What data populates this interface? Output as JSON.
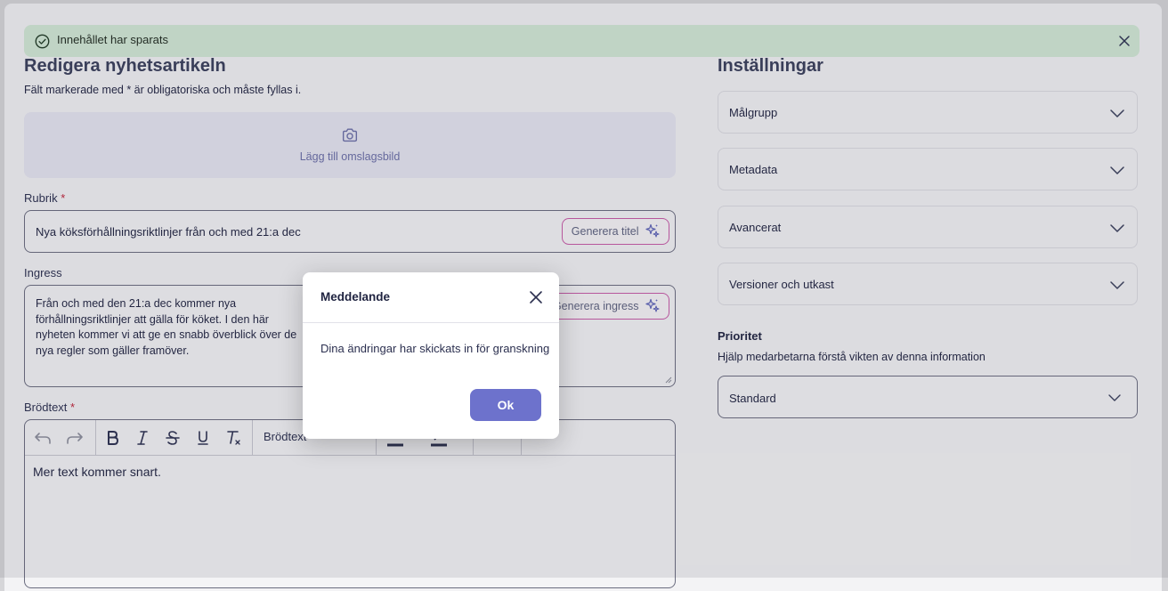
{
  "toast": {
    "message": "Innehållet har sparats"
  },
  "form": {
    "title": "Redigera nyhetsartikeln",
    "required_note": "Fält markerade med * är obligatoriska och måste fyllas i.",
    "cover_label": "Lägg till omslagsbild",
    "rubrik": {
      "label": "Rubrik",
      "required_mark": "*",
      "value": "Nya köksförhållningsriktlinjer från och med 21:a dec",
      "generate_label": "Generera titel"
    },
    "ingress": {
      "label": "Ingress",
      "value": "Från och med den 21:a dec kommer nya förhållningsriktlinjer att gälla för köket. I den här nyheten kommer vi att ge en snabb överblick över de nya regler som gäller framöver.",
      "generate_label": "Generera ingress"
    },
    "brodtext": {
      "label": "Brödtext",
      "required_mark": "*",
      "style_value": "Brödtext",
      "body": "Mer text kommer snart."
    }
  },
  "settings": {
    "title": "Inställningar",
    "accordions": [
      "Målgrupp",
      "Metadata",
      "Avancerat",
      "Versioner och utkast"
    ],
    "priority": {
      "label": "Prioritet",
      "help": "Hjälp medarbetarna förstå vikten av denna information",
      "value": "Standard"
    }
  },
  "modal": {
    "title": "Meddelande",
    "message": "Dina ändringar har skickats in för granskning",
    "ok_label": "Ok"
  },
  "colors": {
    "accent": "#6d72cc",
    "success_bg": "#d3ead6",
    "required": "#c0233a"
  }
}
